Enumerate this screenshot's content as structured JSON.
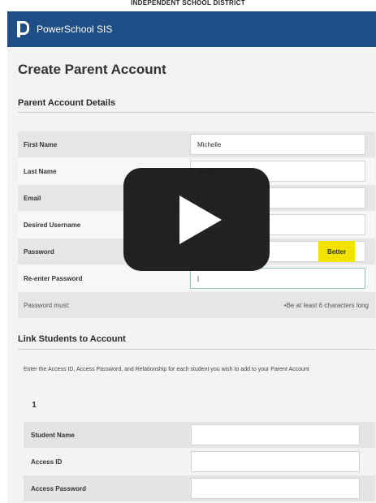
{
  "header": {
    "district_label": "INDEPENDENT SCHOOL DISTRICT",
    "app_name": "PowerSchool SIS"
  },
  "page": {
    "title": "Create Parent Account"
  },
  "parent_section": {
    "title": "Parent Account Details",
    "fields": {
      "first_name": {
        "label": "First Name",
        "value": "Michelle"
      },
      "last_name": {
        "label": "Last Name",
        "value": "Smith"
      },
      "email": {
        "label": "Email",
        "value": "k"
      },
      "username": {
        "label": "Desired Username",
        "value": ""
      },
      "password": {
        "label": "Password",
        "value": "",
        "strength": "Better"
      },
      "reenter": {
        "label": "Re-enter Password",
        "value": "|"
      }
    },
    "password_rule": {
      "label": "Password must:",
      "text": "•Be at least 6 characters long"
    }
  },
  "link_section": {
    "title": "Link Students to Account",
    "instructions": "Enter the Access ID, Access Password, and Relationship for each student you wish to add to your Parent Account",
    "student_number": "1",
    "fields": {
      "student_name": {
        "label": "Student Name"
      },
      "access_id": {
        "label": "Access ID"
      },
      "access_password": {
        "label": "Access Password"
      }
    }
  },
  "overlay": {
    "icon": "play-icon"
  },
  "colors": {
    "header_bg": "#1f4e86",
    "strength_badge": "#f1e200",
    "focus_border": "#8fc9a8"
  }
}
